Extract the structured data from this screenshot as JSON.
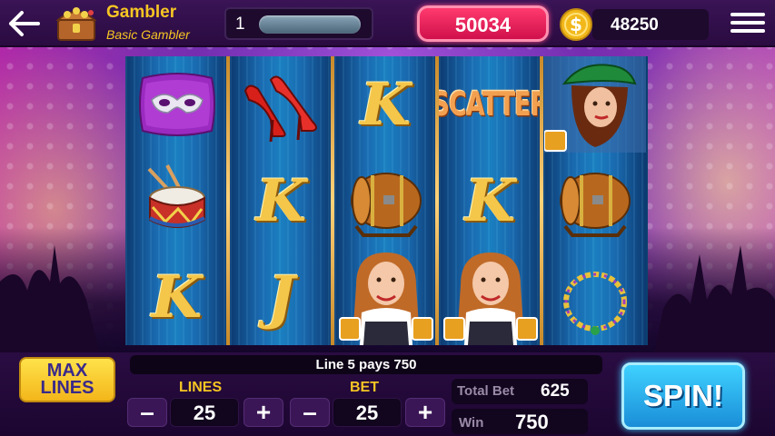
{
  "header": {
    "player_name": "Gambler",
    "player_rank": "Basic Gambler",
    "level": "1",
    "gems": "50034",
    "coins": "48250",
    "icons": [
      "back-arrow-icon",
      "treasure-chest-icon",
      "dollar-coin-icon",
      "hamburger-menu-icon"
    ]
  },
  "reels": [
    {
      "symbols": [
        "mask-pillow",
        "drum",
        "K"
      ]
    },
    {
      "symbols": [
        "red-high-heels",
        "K",
        "J"
      ]
    },
    {
      "symbols": [
        "K",
        "beer-barrel",
        "beer-maid"
      ]
    },
    {
      "symbols": [
        "SCATTER",
        "K",
        "beer-maid"
      ]
    },
    {
      "symbols": [
        "green-hat-lady",
        "beer-barrel",
        "bead-necklace"
      ]
    }
  ],
  "reel_text": {
    "scatter": "SCATTER",
    "k": "K",
    "j": "J"
  },
  "controls": {
    "max_lines_label": "MAX LINES",
    "message": "Line 5 pays 750",
    "lines_label": "LINES",
    "lines_value": "25",
    "bet_label": "BET",
    "bet_value": "25",
    "minus": "–",
    "plus": "+",
    "total_bet_label": "Total Bet",
    "total_bet_value": "625",
    "win_label": "Win",
    "win_value": "750",
    "spin_label": "SPIN!"
  },
  "colors": {
    "gold_text": "#f6c623",
    "gems_pink": "#e8185a",
    "spin_blue": "#2aaef0",
    "max_lines_yellow": "#f8cc2a"
  }
}
